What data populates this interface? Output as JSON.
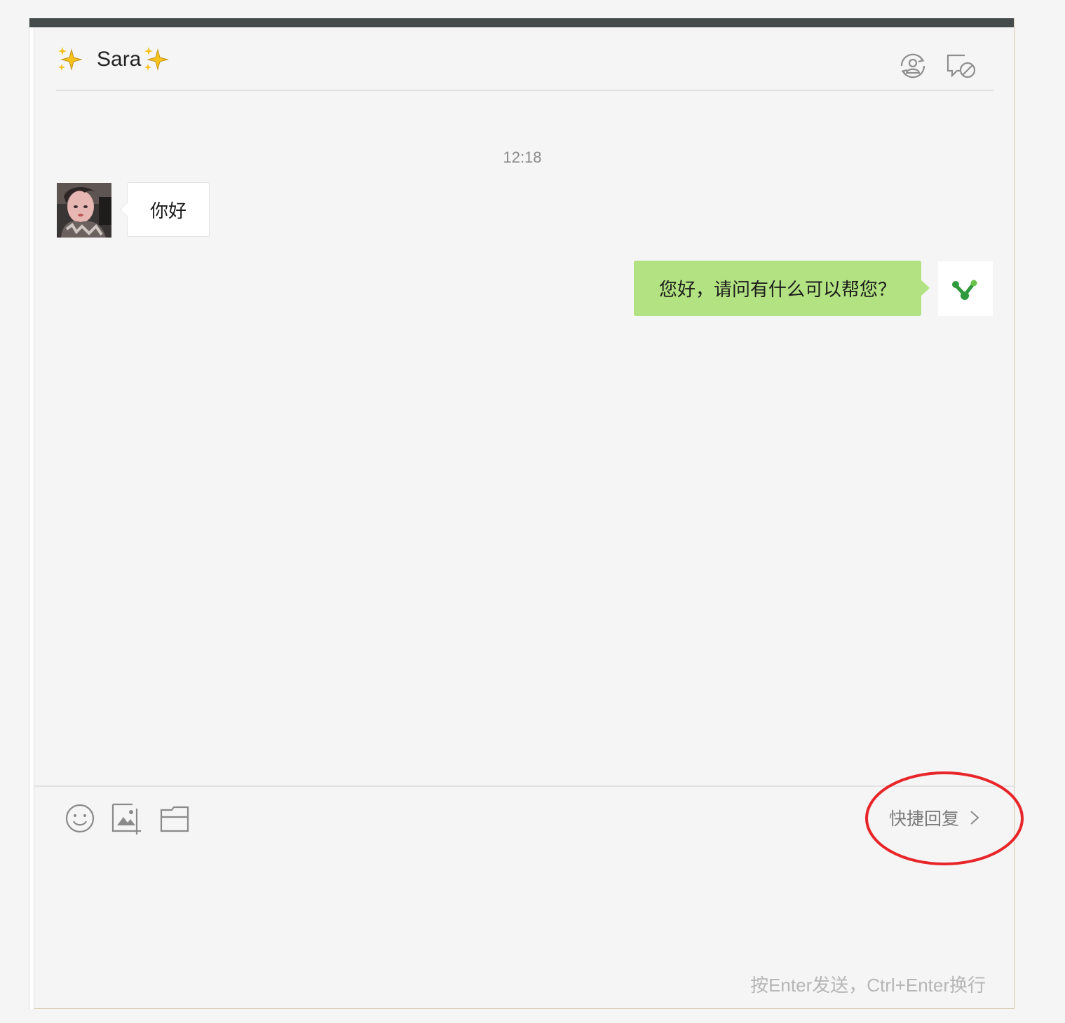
{
  "header": {
    "contact_name": "Sara",
    "name_decoration_icon": "sparkles-icon",
    "actions": [
      {
        "icon": "contact-sync-icon"
      },
      {
        "icon": "block-message-icon"
      }
    ]
  },
  "chat": {
    "timestamp": "12:18",
    "messages": [
      {
        "direction": "incoming",
        "text": "你好",
        "avatar_icon": "user-photo-avatar"
      },
      {
        "direction": "outgoing",
        "text": "您好，请问有什么可以帮您？",
        "avatar_icon": "brand-logo-avatar"
      }
    ]
  },
  "composer": {
    "tools": [
      {
        "icon": "emoji-icon"
      },
      {
        "icon": "image-icon"
      },
      {
        "icon": "folder-icon"
      }
    ],
    "quick_reply_label": "快捷回复",
    "send_hint": "按Enter发送，Ctrl+Enter换行"
  },
  "colors": {
    "top_bar": "#454b4a",
    "outgoing_bubble": "#b2e281",
    "incoming_bubble": "#ffffff",
    "highlight_annotation": "#e8262a"
  }
}
